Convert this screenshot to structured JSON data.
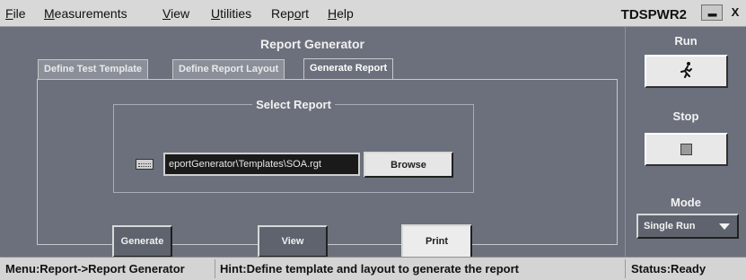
{
  "menubar": {
    "items": [
      {
        "pre": "",
        "ul": "F",
        "post": "ile"
      },
      {
        "pre": "",
        "ul": "M",
        "post": "easurements"
      },
      {
        "pre": "",
        "ul": "V",
        "post": "iew"
      },
      {
        "pre": "",
        "ul": "U",
        "post": "tilities"
      },
      {
        "pre": "Rep",
        "ul": "o",
        "post": "rt"
      },
      {
        "pre": "",
        "ul": "H",
        "post": "elp"
      }
    ],
    "app_name": "TDSPWR2",
    "minimize_label": "■■■",
    "close_label": "X"
  },
  "main": {
    "title": "Report Generator",
    "tabs": [
      {
        "label": "Define Test Template"
      },
      {
        "label": "Define Report Layout"
      },
      {
        "label": "Generate Report"
      }
    ],
    "active_tab": "Generate Report",
    "select_report": {
      "title": "Select Report",
      "path_value": "eportGenerator\\Templates\\SOA.rgt",
      "browse_label": "Browse"
    },
    "buttons": {
      "generate": "Generate",
      "view": "View",
      "print": "Print"
    }
  },
  "side": {
    "run_label": "Run",
    "run_icon": "running-man-icon",
    "stop_label": "Stop",
    "stop_icon": "stop-square-icon",
    "mode_label": "Mode",
    "mode_value": "Single Run"
  },
  "statusbar": {
    "menu": "Menu:Report->Report Generator",
    "hint": "Hint:Define template and layout to generate the report",
    "status": "Status:Ready"
  },
  "colors": {
    "panel_bg": "#6b707c",
    "menubar_bg": "#d8d8d8",
    "button_light": "#ececec"
  }
}
